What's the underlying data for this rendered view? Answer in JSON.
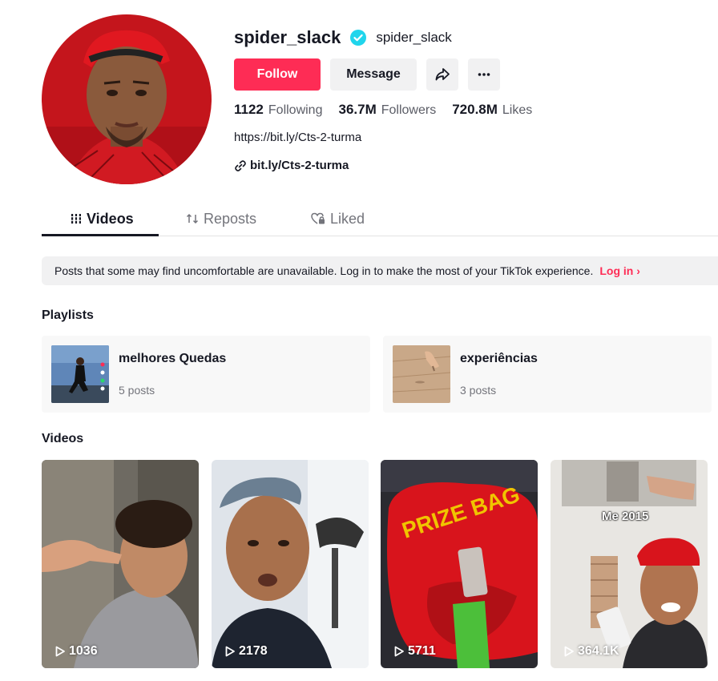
{
  "profile": {
    "username": "spider_slack",
    "nickname": "spider_slack",
    "verified": true,
    "bio": "https://bit.ly/Cts-2-turma",
    "link": "bit.ly/Cts-2-turma"
  },
  "actions": {
    "follow_label": "Follow",
    "message_label": "Message",
    "share_icon": "share-icon",
    "more_icon": "more-icon"
  },
  "stats": {
    "following_count": "1122",
    "following_label": "Following",
    "followers_count": "36.7M",
    "followers_label": "Followers",
    "likes_count": "720.8M",
    "likes_label": "Likes"
  },
  "tabs": [
    {
      "label": "Videos",
      "icon": "grid-icon",
      "active": true
    },
    {
      "label": "Reposts",
      "icon": "repost-icon",
      "active": false
    },
    {
      "label": "Liked",
      "icon": "heart-lock-icon",
      "active": false
    }
  ],
  "notice": {
    "text": "Posts that some may find uncomfortable are unavailable. Log in to make the most of your TikTok experience.",
    "login_label": "Log in"
  },
  "playlists_title": "Playlists",
  "playlists": [
    {
      "title": "melhores Quedas",
      "count": "5 posts"
    },
    {
      "title": "experiências",
      "count": "3 posts"
    }
  ],
  "videos_title": "Videos",
  "videos": [
    {
      "views": "1036"
    },
    {
      "views": "2178"
    },
    {
      "views": "5711",
      "overlay": "PRIZE BAG"
    },
    {
      "views": "364.1K",
      "overlay": "Me 2015"
    }
  ],
  "colors": {
    "brand": "#fe2c55",
    "verified": "#20d5ec",
    "text": "#161823",
    "muted": "#73747b"
  }
}
